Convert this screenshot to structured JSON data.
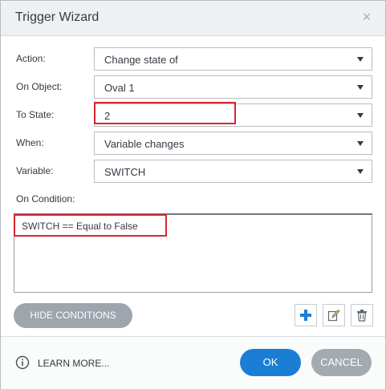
{
  "dialog": {
    "title": "Trigger Wizard",
    "close_glyph": "×"
  },
  "fields": {
    "action": {
      "label": "Action:",
      "value": "Change state of"
    },
    "on_object": {
      "label": "On Object:",
      "value": "Oval 1"
    },
    "to_state": {
      "label": "To State:",
      "value": "2"
    },
    "when": {
      "label": "When:",
      "value": "Variable changes"
    },
    "variable": {
      "label": "Variable:",
      "value": "SWITCH"
    }
  },
  "conditions": {
    "label": "On Condition:",
    "text": "SWITCH == Equal to False",
    "hide_label": "HIDE CONDITIONS"
  },
  "footer": {
    "learn_more": "LEARN MORE...",
    "ok": "OK",
    "cancel": "CANCEL"
  },
  "icons": {
    "close": "close-icon",
    "dropdown": "chevron-down-icon",
    "add": "plus-icon",
    "edit": "edit-icon",
    "delete": "trash-icon",
    "info": "info-icon"
  },
  "colors": {
    "accent": "#1a7fd4",
    "highlight": "#d8262e",
    "secondary_button": "#9ea5ad"
  }
}
